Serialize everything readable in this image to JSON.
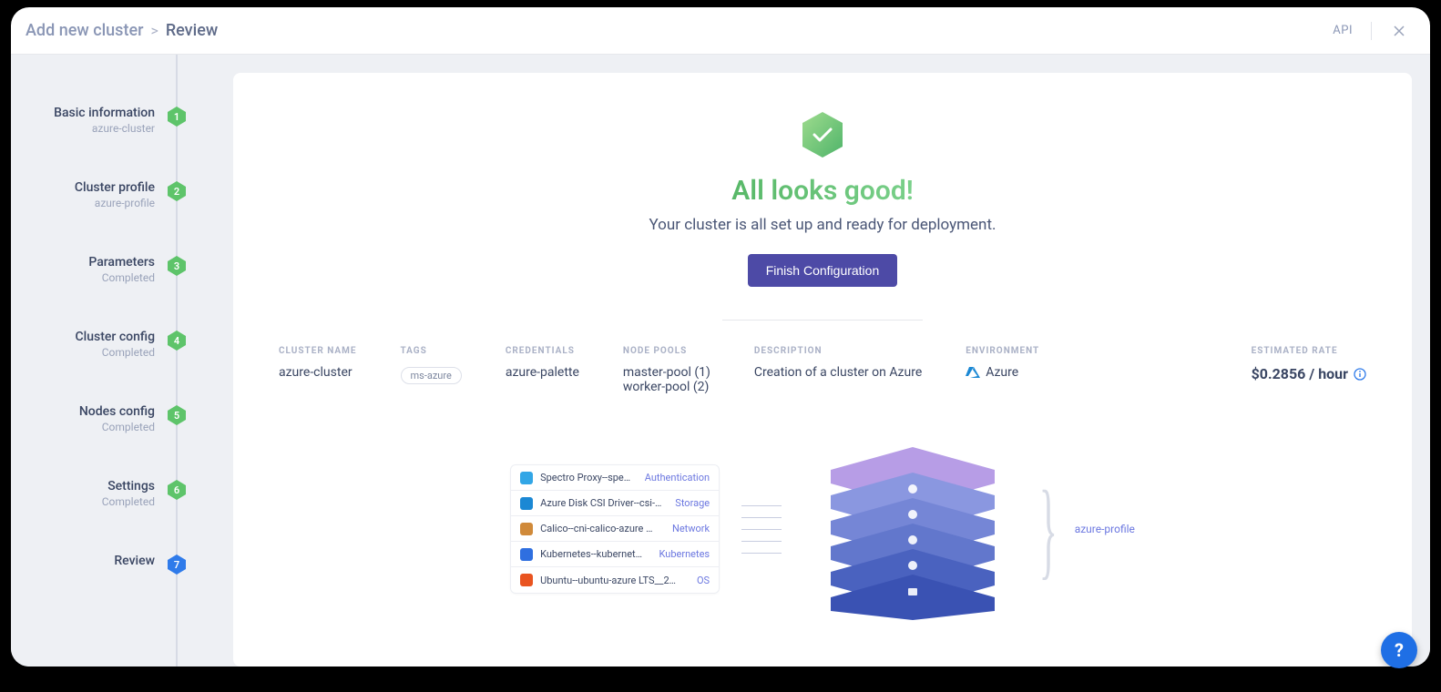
{
  "breadcrumb": {
    "root": "Add new cluster",
    "sep": ">",
    "current": "Review"
  },
  "header": {
    "api": "API"
  },
  "steps": [
    {
      "title": "Basic information",
      "sub": "azure-cluster",
      "num": "1",
      "color": "#5ec46a"
    },
    {
      "title": "Cluster profile",
      "sub": "azure-profile",
      "num": "2",
      "color": "#5ec46a"
    },
    {
      "title": "Parameters",
      "sub": "Completed",
      "num": "3",
      "color": "#5ec46a"
    },
    {
      "title": "Cluster config",
      "sub": "Completed",
      "num": "4",
      "color": "#5ec46a"
    },
    {
      "title": "Nodes config",
      "sub": "Completed",
      "num": "5",
      "color": "#5ec46a"
    },
    {
      "title": "Settings",
      "sub": "Completed",
      "num": "6",
      "color": "#5ec46a"
    },
    {
      "title": "Review",
      "sub": "",
      "num": "7",
      "color": "#2f7bea"
    }
  ],
  "hero": {
    "title": "All looks good!",
    "subtitle": "Your cluster is all set up and ready for deployment.",
    "button": "Finish Configuration"
  },
  "summary": {
    "cluster_name": {
      "label": "CLUSTER NAME",
      "value": "azure-cluster"
    },
    "tags": {
      "label": "TAGS",
      "value": "ms-azure"
    },
    "credentials": {
      "label": "CREDENTIALS",
      "value": "azure-palette"
    },
    "node_pools": {
      "label": "NODE POOLS",
      "lines": [
        "master-pool (1)",
        "worker-pool (2)"
      ]
    },
    "description": {
      "label": "DESCRIPTION",
      "value": "Creation of a cluster on Azure"
    },
    "environment": {
      "label": "ENVIRONMENT",
      "value": "Azure"
    },
    "rate": {
      "label": "ESTIMATED RATE",
      "value": "$0.2856 / hour"
    }
  },
  "profile": {
    "name": "azure-profile",
    "layers": [
      {
        "name": "Spectro Proxy--spe…",
        "type": "Authentication",
        "icon": "#32a6e6"
      },
      {
        "name": "Azure Disk CSI Driver--csi-…",
        "type": "Storage",
        "icon": "#1b88d4"
      },
      {
        "name": "Calico--cni-calico-azure …",
        "type": "Network",
        "icon": "#d08a3a"
      },
      {
        "name": "Kubernetes--kubernet…",
        "type": "Kubernetes",
        "icon": "#2f6fe0"
      },
      {
        "name": "Ubuntu--ubuntu-azure LTS__2…",
        "type": "OS",
        "icon": "#e95420"
      }
    ],
    "stack_colors": [
      "#b79de6",
      "#8a97e0",
      "#7586d6",
      "#6277cc",
      "#4a62bf",
      "#3a52b3"
    ]
  },
  "help": "?"
}
